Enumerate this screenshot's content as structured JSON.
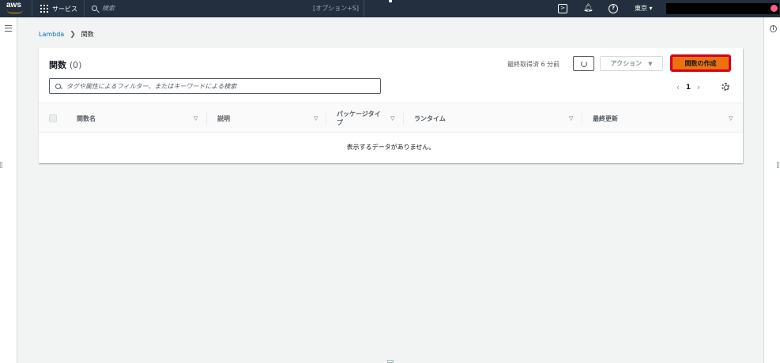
{
  "nav": {
    "logo": "aws",
    "services_label": "サービス",
    "search_placeholder": "検索",
    "search_shortcut": "[オプション+S]",
    "region_label": "東京 ▾"
  },
  "breadcrumb": {
    "root": "Lambda",
    "current": "関数"
  },
  "panel": {
    "title": "関数",
    "count": "(0)",
    "last_fetched": "最終取得済 6 分前",
    "action_label": "アクション",
    "create_label": "関数の作成",
    "filter_placeholder": "タグや属性によるフィルター、またはキーワードによる検索",
    "page_number": "1"
  },
  "table": {
    "columns": [
      "関数名",
      "説明",
      "パッケージタイプ",
      "ランタイム",
      "最終更新"
    ],
    "empty_message": "表示するデータがありません。"
  }
}
